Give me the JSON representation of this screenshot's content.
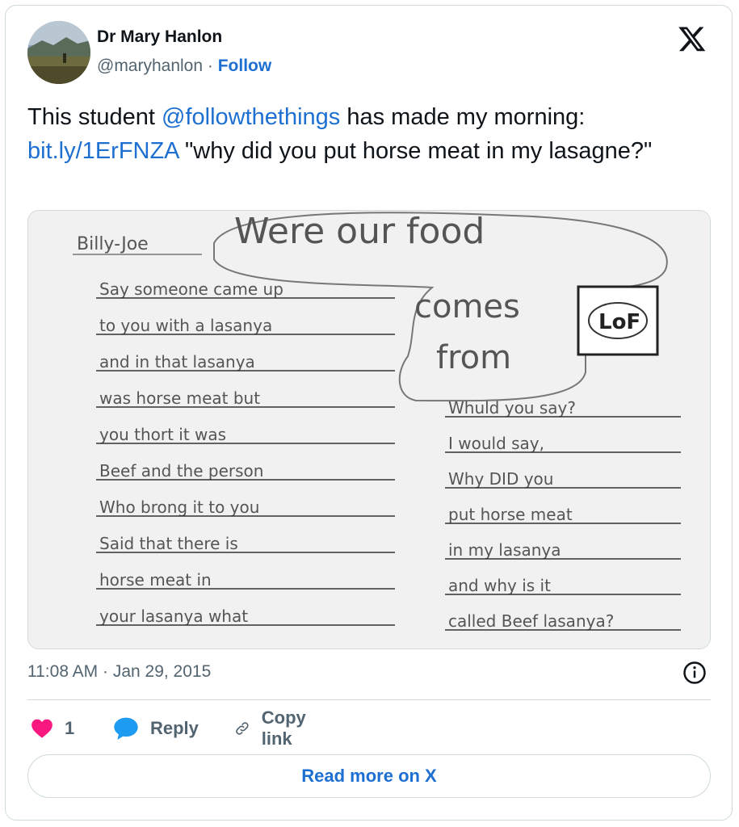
{
  "author": {
    "name": "Dr Mary Hanlon",
    "handle": "@maryhanlon",
    "separator": "·",
    "follow_label": "Follow",
    "avatar_icon": "landscape-avatar"
  },
  "tweet": {
    "text_before": "This student ",
    "mention": "@followthethings",
    "text_middle": " has made my morning: ",
    "link": "bit.ly/1ErFNZA",
    "text_after": " \"why did you put horse meat in my lasagne?\""
  },
  "media": {
    "name_label": "Billy-Joe",
    "bubble_title_1": "Were our food",
    "bubble_title_2": "comes",
    "bubble_title_3": "from",
    "logo_text": "LoF",
    "left_lines": [
      "Say someone came up",
      "to you with a lasanya",
      "and in that lasanya",
      "was horse meat but",
      "you thort it was",
      "Beef and the person",
      "Who brong it to you",
      "Said that there is",
      "horse meat in",
      "your lasanya what"
    ],
    "right_lines": [
      "Whuld you say?",
      "I would say,",
      "Why DID you",
      "put horse meat",
      "in my lasanya",
      "and why is it",
      "called Beef lasanya?"
    ]
  },
  "meta": {
    "timestamp": "11:08 AM · Jan 29, 2015"
  },
  "actions": {
    "like_count": "1",
    "reply_label": "Reply",
    "copy_label": "Copy link",
    "read_more_label": "Read more on X"
  },
  "colors": {
    "link_blue": "#1d6fd1",
    "heart_pink": "#f91880",
    "reply_blue": "#1d9bf0",
    "border": "#cfd9de"
  }
}
